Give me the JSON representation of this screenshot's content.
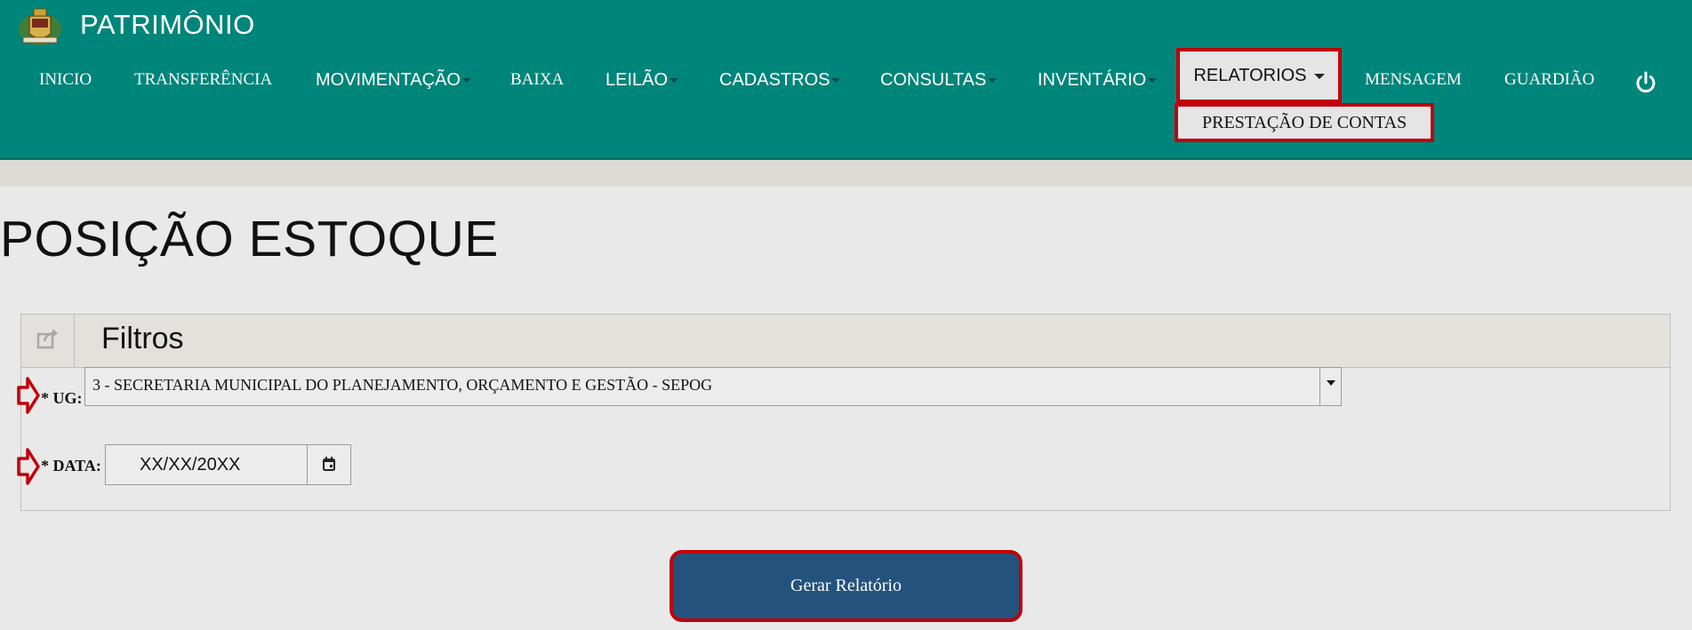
{
  "app": {
    "title": "PATRIMÔNIO"
  },
  "nav": {
    "items": [
      {
        "label": "INICIO"
      },
      {
        "label": "TRANSFERÊNCIA"
      },
      {
        "label": "MOVIMENTAÇÃO"
      },
      {
        "label": "BAIXA"
      },
      {
        "label": "LEILÃO"
      },
      {
        "label": "CADASTROS"
      },
      {
        "label": "CONSULTAS"
      },
      {
        "label": "INVENTÁRIO"
      },
      {
        "label": "RELATORIOS"
      },
      {
        "label": "MENSAGEM"
      },
      {
        "label": "GUARDIÃO"
      }
    ],
    "dropdown": {
      "items": [
        {
          "label": "PRESTAÇÃO DE CONTAS"
        }
      ]
    },
    "power_icon": "power-icon"
  },
  "page": {
    "title": "POSIÇÃO ESTOQUE"
  },
  "filters": {
    "title": "Filtros",
    "icon": "share-icon",
    "ug": {
      "label": "* UG:",
      "value": "3 - SECRETARIA MUNICIPAL DO PLANEJAMENTO, ORÇAMENTO E GESTÃO - SEPOG"
    },
    "date": {
      "label": "* DATA:",
      "value": "XX/XX/20XX",
      "icon": "calendar-icon"
    }
  },
  "actions": {
    "generate_label": "Gerar Relatório"
  },
  "colors": {
    "header": "#00857a",
    "highlight": "#c0000a",
    "primary_button": "#23527c"
  }
}
